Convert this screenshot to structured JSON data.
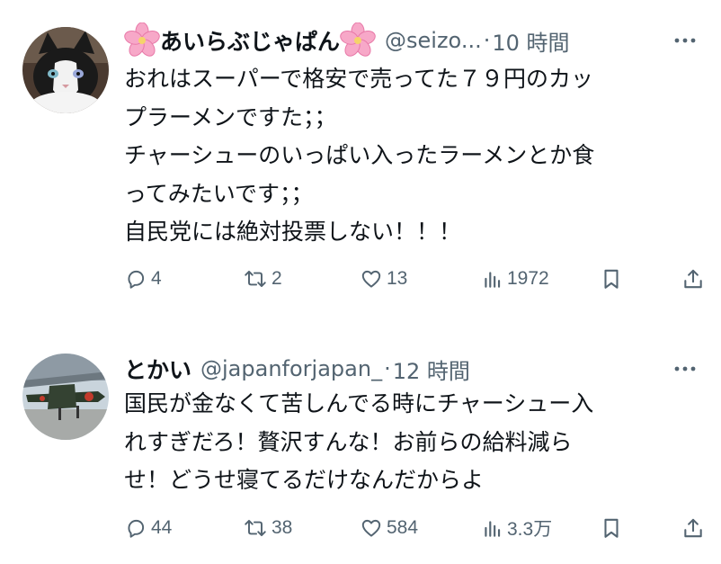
{
  "colors": {
    "text": "#0f1419",
    "secondary": "#536471",
    "background": "#ffffff",
    "flower": "#f7a8c8"
  },
  "posts": [
    {
      "display_name": "あいらぶじゃぱん",
      "name_decoration": "cherry-blossom-icon",
      "handle": "@seizo...",
      "separator": "·",
      "time": "10 時間",
      "text_lines": [
        "おれはスーパーで格安で売ってた７９円のカッ",
        "プラーメンですた；；",
        "チャーシューのいっぱい入ったラーメンとか食",
        "ってみたいです；；",
        "自民党には絶対投票しない！！！"
      ],
      "replies": "4",
      "reposts": "2",
      "likes": "13",
      "views": "1972"
    },
    {
      "display_name": "とかい",
      "handle": "@japanforjapan_",
      "separator": "·",
      "time": "12 時間",
      "text_lines": [
        "国民が金なくて苦しんでる時にチャーシュー入",
        "れすぎだろ！贅沢すんな！お前らの給料減ら",
        "せ！どうせ寝てるだけなんだからよ"
      ],
      "replies": "44",
      "reposts": "38",
      "likes": "584",
      "views": "3.3万"
    }
  ]
}
